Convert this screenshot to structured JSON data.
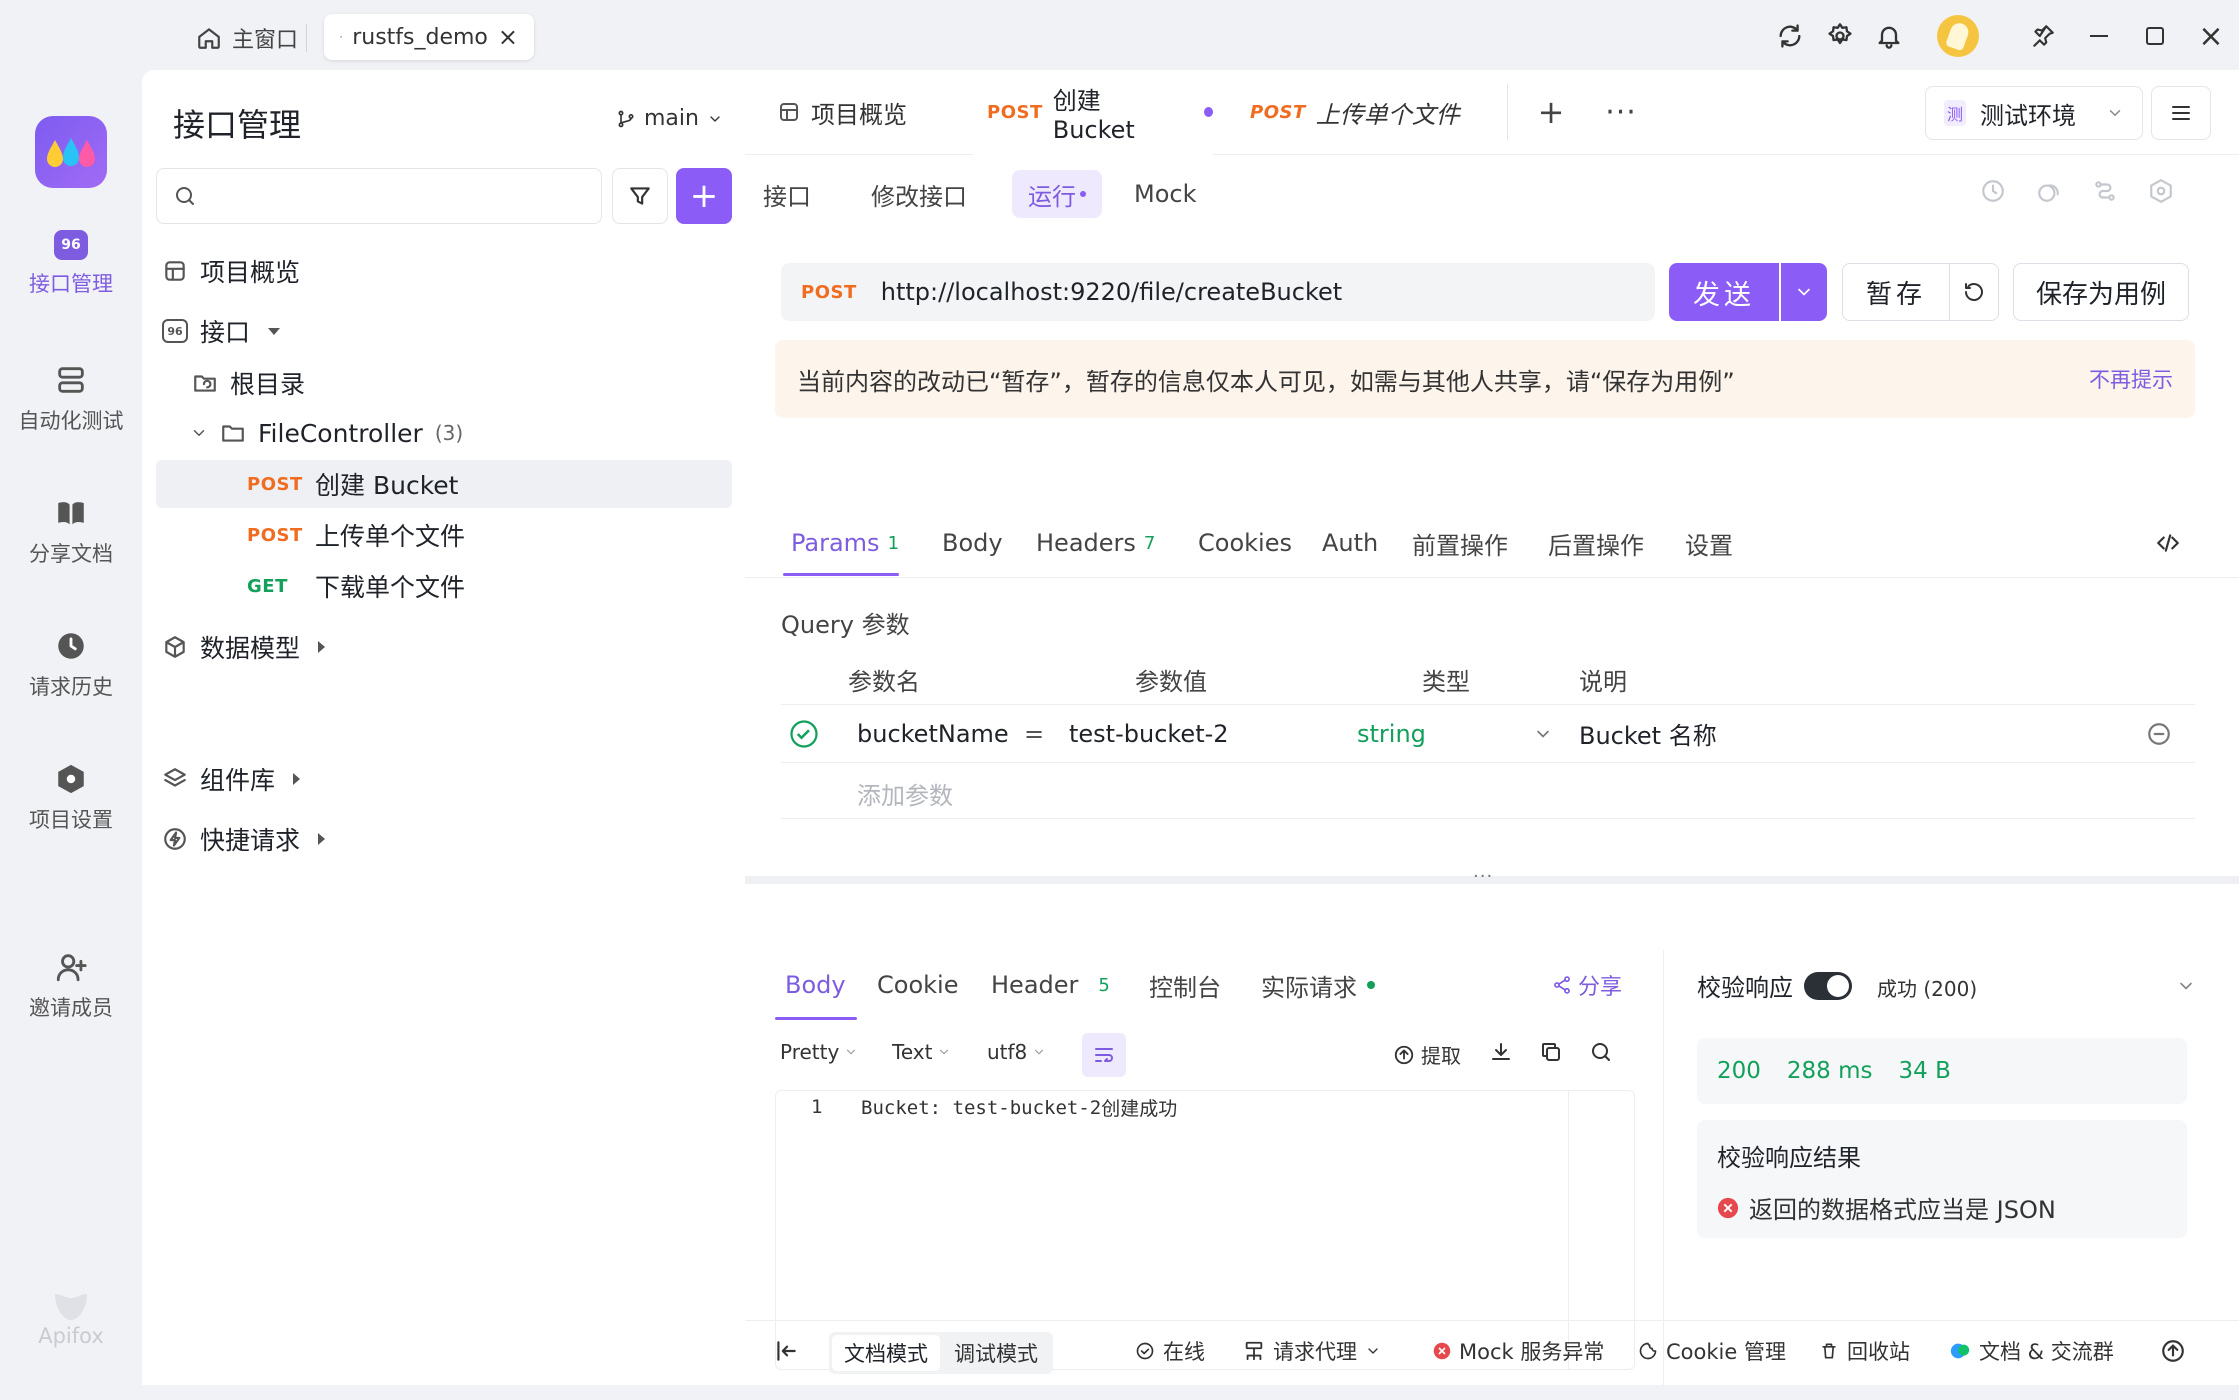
{
  "titlebar": {
    "home_tab": "主窗口",
    "project_tab": "rustfs_demo"
  },
  "rail": {
    "items": [
      "接口管理",
      "自动化测试",
      "分享文档",
      "请求历史",
      "项目设置",
      "邀请成员"
    ],
    "brand": "Apifox"
  },
  "sidebar": {
    "title": "接口管理",
    "branch": "main",
    "search_placeholder": "",
    "overview": "项目概览",
    "apis": "接口",
    "root": "根目录",
    "folder": "FileController",
    "folder_count": "(3)",
    "endpoints": [
      {
        "method": "POST",
        "name": "创建 Bucket"
      },
      {
        "method": "POST",
        "name": "上传单个文件"
      },
      {
        "method": "GET",
        "name": "下载单个文件"
      }
    ],
    "schemas": "数据模型",
    "components": "组件库",
    "quick": "快捷请求"
  },
  "doc_tabs": {
    "overview": "项目概览",
    "active_method": "POST",
    "active_name": "创建 Bucket",
    "other_method": "POST",
    "other_name": "上传单个文件"
  },
  "env": "测试环境",
  "env_badge": "测",
  "sub_tabs": [
    "接口",
    "修改接口",
    "运行",
    "Mock"
  ],
  "request": {
    "method": "POST",
    "url": "http://localhost:9220/file/createBucket",
    "send": "发送",
    "save_temp": "暂存",
    "save_case": "保存为用例"
  },
  "notice": {
    "text": "当前内容的改动已“暂存”，暂存的信息仅本人可见，如需与其他人共享，请“保存为用例”",
    "dismiss": "不再提示"
  },
  "param_tabs": {
    "params": "Params",
    "params_count": "1",
    "body": "Body",
    "headers": "Headers",
    "headers_count": "7",
    "cookies": "Cookies",
    "auth": "Auth",
    "pre": "前置操作",
    "post": "后置操作",
    "settings": "设置"
  },
  "query": {
    "title": "Query 参数",
    "headers": [
      "参数名",
      "参数值",
      "类型",
      "说明"
    ],
    "row": {
      "name": "bucketName",
      "eq": "=",
      "value": "test-bucket-2",
      "type": "string",
      "desc": "Bucket 名称"
    },
    "add_placeholder": "添加参数"
  },
  "response_tabs": {
    "body": "Body",
    "cookie": "Cookie",
    "header": "Header",
    "header_count": "5",
    "console": "控制台",
    "actual": "实际请求",
    "share": "分享"
  },
  "response_toolbar": {
    "pretty": "Pretty",
    "text": "Text",
    "encoding": "utf8",
    "extract": "提取"
  },
  "response_body": {
    "line_no": "1",
    "code": "Bucket: test-bucket-2",
    "suffix": " 创建成功"
  },
  "validation": {
    "title": "校验响应",
    "status": "成功 (200)",
    "code": "200",
    "time": "288 ms",
    "size": "34 B",
    "result_title": "校验响应结果",
    "error": "返回的数据格式应当是 JSON"
  },
  "statusbar": {
    "doc_mode": "文档模式",
    "debug_mode": "调试模式",
    "online": "在线",
    "proxy": "请求代理",
    "mock": "Mock 服务异常",
    "cookie": "Cookie 管理",
    "trash": "回收站",
    "community": "文档 & 交流群"
  },
  "colors": {
    "accent": "#8b5cf6",
    "post": "#f06c20",
    "get": "#12a05b",
    "notice_bg": "#fdf4ec",
    "success": "#12a05b",
    "error": "#e5484d"
  }
}
